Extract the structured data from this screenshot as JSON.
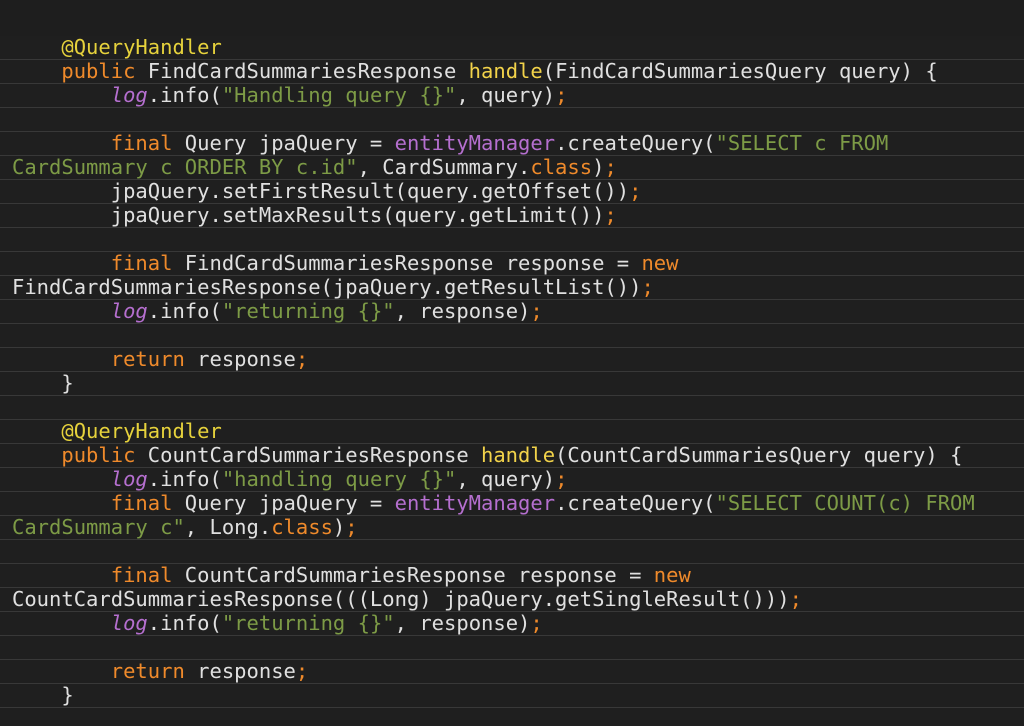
{
  "editor": {
    "background": "#1f1f1f",
    "line_rule_color": "#383838",
    "syntax_colors": {
      "annotation": "#e6d23c",
      "keyword": "#ef8a2b",
      "method_name": "#f2d34a",
      "string": "#7d9b46",
      "field": "#b56fcf",
      "plain": "#e0e0e0"
    }
  },
  "lines": [
    [
      {
        "t": "ann",
        "s": "    @QueryHandler"
      }
    ],
    [
      {
        "t": "kw",
        "s": "    public"
      },
      {
        "t": "p",
        "s": " FindCardSummariesResponse "
      },
      {
        "t": "fn",
        "s": "handle"
      },
      {
        "t": "p",
        "s": "(FindCardSummariesQuery query) {"
      }
    ],
    [
      {
        "t": "p",
        "s": "        "
      },
      {
        "t": "fi",
        "s": "log"
      },
      {
        "t": "p",
        "s": ".info("
      },
      {
        "t": "str",
        "s": "\"Handling query {}\""
      },
      {
        "t": "p",
        "s": ", query)"
      },
      {
        "t": "kw",
        "s": ";"
      }
    ],
    [],
    [
      {
        "t": "kw",
        "s": "        final"
      },
      {
        "t": "p",
        "s": " Query jpaQuery = "
      },
      {
        "t": "f",
        "s": "entityManager"
      },
      {
        "t": "p",
        "s": ".createQuery("
      },
      {
        "t": "str",
        "s": "\"SELECT c FROM"
      }
    ],
    [
      {
        "t": "str",
        "s": "CardSummary c ORDER BY c.id\""
      },
      {
        "t": "p",
        "s": ", CardSummary."
      },
      {
        "t": "kw",
        "s": "class"
      },
      {
        "t": "p",
        "s": ")"
      },
      {
        "t": "kw",
        "s": ";"
      }
    ],
    [
      {
        "t": "p",
        "s": "        jpaQuery.setFirstResult(query.getOffset())"
      },
      {
        "t": "kw",
        "s": ";"
      }
    ],
    [
      {
        "t": "p",
        "s": "        jpaQuery.setMaxResults(query.getLimit())"
      },
      {
        "t": "kw",
        "s": ";"
      }
    ],
    [],
    [
      {
        "t": "kw",
        "s": "        final"
      },
      {
        "t": "p",
        "s": " FindCardSummariesResponse response = "
      },
      {
        "t": "kw",
        "s": "new"
      }
    ],
    [
      {
        "t": "p",
        "s": "FindCardSummariesResponse(jpaQuery.getResultList())"
      },
      {
        "t": "kw",
        "s": ";"
      }
    ],
    [
      {
        "t": "p",
        "s": "        "
      },
      {
        "t": "fi",
        "s": "log"
      },
      {
        "t": "p",
        "s": ".info("
      },
      {
        "t": "str",
        "s": "\"returning {}\""
      },
      {
        "t": "p",
        "s": ", response)"
      },
      {
        "t": "kw",
        "s": ";"
      }
    ],
    [],
    [
      {
        "t": "kw",
        "s": "        return"
      },
      {
        "t": "p",
        "s": " response"
      },
      {
        "t": "kw",
        "s": ";"
      }
    ],
    [
      {
        "t": "p",
        "s": "    }"
      }
    ],
    [],
    [
      {
        "t": "ann",
        "s": "    @QueryHandler"
      }
    ],
    [
      {
        "t": "kw",
        "s": "    public"
      },
      {
        "t": "p",
        "s": " CountCardSummariesResponse "
      },
      {
        "t": "fn",
        "s": "handle"
      },
      {
        "t": "p",
        "s": "(CountCardSummariesQuery query) {"
      }
    ],
    [
      {
        "t": "p",
        "s": "        "
      },
      {
        "t": "fi",
        "s": "log"
      },
      {
        "t": "p",
        "s": ".info("
      },
      {
        "t": "str",
        "s": "\"handling query {}\""
      },
      {
        "t": "p",
        "s": ", query)"
      },
      {
        "t": "kw",
        "s": ";"
      }
    ],
    [
      {
        "t": "kw",
        "s": "        final"
      },
      {
        "t": "p",
        "s": " Query jpaQuery = "
      },
      {
        "t": "f",
        "s": "entityManager"
      },
      {
        "t": "p",
        "s": ".createQuery("
      },
      {
        "t": "str",
        "s": "\"SELECT COUNT(c) FROM"
      }
    ],
    [
      {
        "t": "str",
        "s": "CardSummary c\""
      },
      {
        "t": "p",
        "s": ", Long."
      },
      {
        "t": "kw",
        "s": "class"
      },
      {
        "t": "p",
        "s": ")"
      },
      {
        "t": "kw",
        "s": ";"
      }
    ],
    [],
    [
      {
        "t": "kw",
        "s": "        final"
      },
      {
        "t": "p",
        "s": " CountCardSummariesResponse response = "
      },
      {
        "t": "kw",
        "s": "new"
      }
    ],
    [
      {
        "t": "p",
        "s": "CountCardSummariesResponse(((Long) jpaQuery.getSingleResult()))"
      },
      {
        "t": "kw",
        "s": ";"
      }
    ],
    [
      {
        "t": "p",
        "s": "        "
      },
      {
        "t": "fi",
        "s": "log"
      },
      {
        "t": "p",
        "s": ".info("
      },
      {
        "t": "str",
        "s": "\"returning {}\""
      },
      {
        "t": "p",
        "s": ", response)"
      },
      {
        "t": "kw",
        "s": ";"
      }
    ],
    [],
    [
      {
        "t": "kw",
        "s": "        return"
      },
      {
        "t": "p",
        "s": " response"
      },
      {
        "t": "kw",
        "s": ";"
      }
    ],
    [
      {
        "t": "p",
        "s": "    }"
      }
    ]
  ]
}
